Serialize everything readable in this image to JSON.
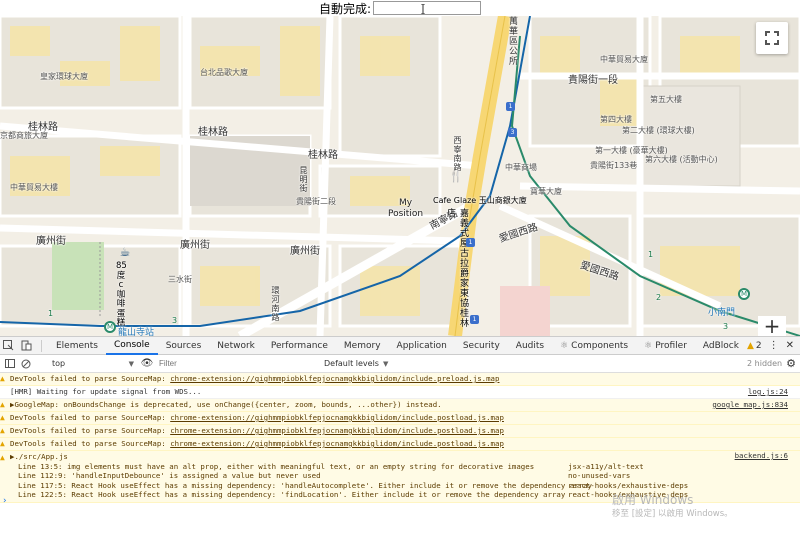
{
  "autocomplete": {
    "label": "自動完成:",
    "value": ""
  },
  "map": {
    "roads": [
      "桂林路",
      "桂林路",
      "廣州街",
      "廣州街",
      "廣州街",
      "南寧路",
      "貴陽街一段",
      "愛國西路",
      "愛國西路",
      "貴陽街一段",
      "中華路一段",
      "中華路一段"
    ],
    "small_labels": [
      "中華路一段",
      "皇家環球大廈",
      "台北品歌大廈",
      "京都商旅大廈",
      "中華貿易大樓",
      "貴陽街二段",
      "桂林路",
      "康定路",
      "三水街",
      "中華貿易大廈",
      "三水街",
      "第五大樓",
      "第四大樓",
      "第二大樓 (環球大樓)",
      "第一大樓 (豪華大樓)",
      "第六大樓 (活動中心)",
      "貴陽街133巷",
      "寶華大廈",
      "中華商場"
    ],
    "vertical_labels": [
      "萬華區公所",
      "西寧南路",
      "昆明街",
      "環河南路"
    ],
    "poi_vertical": [
      "雙喜餐廳",
      "米糧",
      "85度C 咖啡蛋糕"
    ],
    "gaya_label": "Cafe Glaze 玉山商銀大廈",
    "gaya_vertical": "嘉義式屋古拉爵家東協桂林店",
    "my_position": [
      "My",
      "Position"
    ],
    "cafe_label": [
      "85",
      "度",
      "c",
      "咖",
      "啡",
      "蛋",
      "糕"
    ],
    "metro_stations": [
      "龍山寺站",
      "小南門"
    ],
    "exit_labels": [
      "1",
      "3",
      "1",
      "2",
      "3",
      "4"
    ],
    "route_badges": [
      "1",
      "1",
      "3",
      "1"
    ]
  },
  "devtools": {
    "tabs": [
      "Elements",
      "Console",
      "Sources",
      "Network",
      "Performance",
      "Memory",
      "Application",
      "Security",
      "Audits",
      "Components",
      "Profiler",
      "AdBlock"
    ],
    "active_tab": "Console",
    "warning_count": "2",
    "context": "top",
    "filter_placeholder": "Filter",
    "levels": "Default levels",
    "hidden": "2 hidden",
    "lines": [
      {
        "type": "warn",
        "text": "DevTools failed to parse SourceMap: ",
        "link": "chrome-extension://gighmmpiobklfepjocnamgkkbiglidom/include.preload.js.map",
        "src": ""
      },
      {
        "type": "info",
        "text": "[HMR] Waiting for update signal from WDS...",
        "link": "",
        "src": "log.js:24"
      },
      {
        "type": "warn",
        "text": "▶GoogleMap: onBoundsChange is deprecated, use onChange({center, zoom, bounds, ...other}) instead.",
        "link": "",
        "src": "google_map.js:834"
      },
      {
        "type": "warn",
        "text": "DevTools failed to parse SourceMap: ",
        "link": "chrome-extension://gighmmpiobklfepjocnamgkkbiglidom/include.postload.js.map",
        "src": ""
      },
      {
        "type": "warn",
        "text": "DevTools failed to parse SourceMap: ",
        "link": "chrome-extension://gighmmpiobklfepjocnamgkkbiglidom/include.postload.js.map",
        "src": ""
      },
      {
        "type": "warn",
        "text": "DevTools failed to parse SourceMap: ",
        "link": "chrome-extension://gighmmpiobklfepjocnamgkkbiglidom/include.postload.js.map",
        "src": ""
      }
    ],
    "app_warning": {
      "title": "▶./src/App.js",
      "src": "backend.js:6",
      "rows": [
        {
          "text": "Line 13:5:   img elements must have an alt prop, either with meaningful text, or an empty string for decorative images",
          "rule": "jsx-a11y/alt-text"
        },
        {
          "text": "Line 112:9:  'handleInputDebounce' is assigned a value but never used",
          "rule": "no-unused-vars"
        },
        {
          "text": "Line 117:5:  React Hook useEffect has a missing dependency: 'handleAutocomplete'. Either include it or remove the dependency array",
          "rule": "react-hooks/exhaustive-deps"
        },
        {
          "text": "Line 122:5:  React Hook useEffect has a missing dependency: 'findLocation'. Either include it or remove the dependency array",
          "rule": "react-hooks/exhaustive-deps"
        }
      ]
    },
    "prompt": "›"
  },
  "watermark": {
    "line1": "啟用 Windows",
    "line2": "移至 [設定] 以啟用 Windows。"
  },
  "icons": {
    "fullscreen": "fullscreen-icon",
    "zoom": "zoom-in-icon",
    "cursor": "text-cursor-icon"
  },
  "colors": {
    "highway": "#f7d774",
    "metro_blue": "#1565a8",
    "metro_green": "#2a8a6a",
    "park": "#c8e2b8",
    "block": "#e9e5dc"
  }
}
